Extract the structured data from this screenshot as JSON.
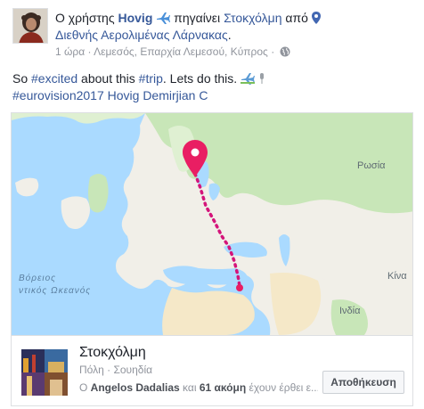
{
  "post": {
    "header": {
      "prefix": "Ο χρήστης",
      "author": "Hovig",
      "verb": "πηγαίνει",
      "destination": "Στοκχόλμη",
      "from_word": "από",
      "origin": "Διεθνής Αερολιμένας Λάρνακας",
      "end_punct": "."
    },
    "meta": {
      "time": "1 ώρα",
      "separator": "·",
      "location": "Λεμεσός, Επαρχία Λεμεσού, Κύπρος",
      "separator2": "·"
    },
    "text": {
      "part1": "So ",
      "tag_excited": "#excited",
      "part2": " about this ",
      "tag_trip": "#trip",
      "part3": ". Lets do this.",
      "tag_eurovision": "#eurovision2017",
      "mention_hovig": "Hovig Demirjian C"
    }
  },
  "map": {
    "labels": {
      "russia": "Ρωσία",
      "atlantic_line1": "Βόρειος",
      "atlantic_line2": "ντικός Ωκεανός",
      "china": "Κίνα",
      "india": "Ινδία"
    },
    "colors": {
      "water": "#aadaff",
      "land": "#f1efe8",
      "forest": "#c8e6b8",
      "desert": "#f5e8c8",
      "route": "#d4147a"
    }
  },
  "place": {
    "name": "Στοκχόλμη",
    "type": "Πόλη · Σουηδία",
    "friends_prefix": "Ο ",
    "friend_name": "Angelos Dadalias",
    "friends_mid": " και ",
    "friends_count": "61 ακόμη",
    "friends_suffix": " έχουν έρθει ε...",
    "save_label": "Αποθήκευση"
  }
}
